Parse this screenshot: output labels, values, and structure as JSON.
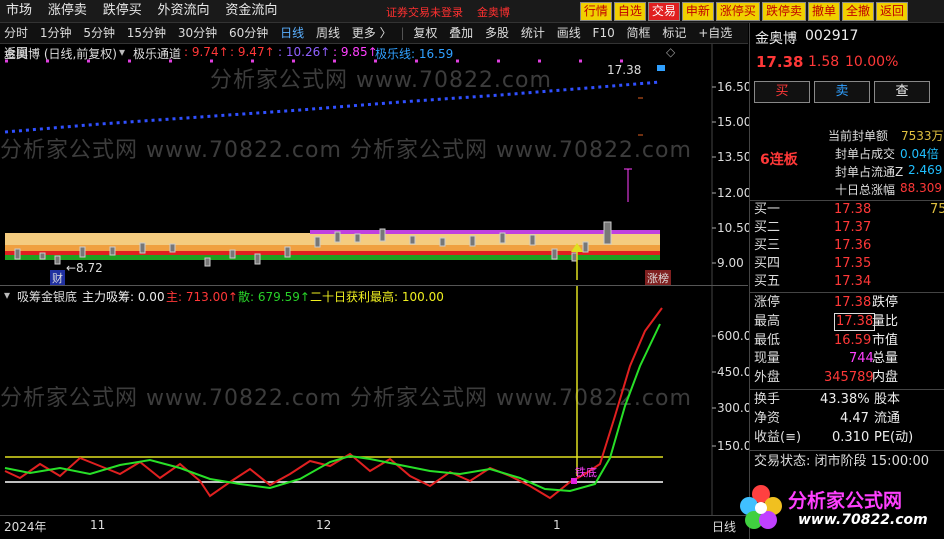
{
  "topmenu": [
    "市场",
    "涨停卖",
    "跌停买",
    "外资流向",
    "资金流向"
  ],
  "login_notice": "证券交易未登录",
  "login_stock": "金奥博",
  "toolbar_buttons": [
    "行情",
    "自选",
    "交易",
    "申新",
    "涨停买",
    "跌停卖",
    "撤单",
    "全撤",
    "返回"
  ],
  "periods": [
    "分时",
    "1分钟",
    "5分钟",
    "15分钟",
    "30分钟",
    "60分钟",
    "日线",
    "周线",
    "更多 〉"
  ],
  "active_period": "日线",
  "tools": [
    "复权",
    "叠加",
    "多股",
    "统计",
    "画线",
    "F10",
    "简框",
    "标记",
    "+自选",
    "返回"
  ],
  "pane1": {
    "title": "金奥博 (日线,前复权)",
    "indicator": "极乐通道",
    "v1": ": 9.74↑",
    "v2": ": 9.47↑",
    "v3": ": 10.26↑",
    "v4": ": 9.85↑",
    "v5": "极乐线: 16.59",
    "high_label": "17.38",
    "low_label": "←8.72",
    "cai_label": "财",
    "zhangbang_label": "涨榜",
    "axis": [
      "16.50",
      "15.00",
      "13.50",
      "12.00",
      "10.50",
      "9.00"
    ]
  },
  "pane2": {
    "name": "吸筹金银底",
    "main_label": "主力吸筹: 0.00",
    "zhu_label": "主: 713.00↑",
    "san_label": "散: 679.59↑",
    "profit_label": "二十日获利最高: 100.00",
    "tiedi_label": "铁底",
    "axis": [
      "600.0",
      "450.0",
      "300.0",
      "150.0"
    ]
  },
  "dates": [
    "2024年",
    "11",
    "12",
    "1"
  ],
  "date_corner": "日线",
  "stock": {
    "name": "金奥博",
    "code": "002917",
    "price": "17.38",
    "change": "1.58",
    "pct": "10.00%",
    "buy": "买",
    "sell": "卖",
    "query": "查",
    "streak": "6连板",
    "seal_amount_lbl": "当前封单额",
    "seal_amount": "7533万",
    "seal_vol_lbl": "封单占成交",
    "seal_vol": "0.04倍",
    "seal_float_lbl": "封单占流通Z",
    "seal_float": "2.469",
    "ten_day_lbl": "十日总涨幅",
    "ten_day": "88.309"
  },
  "orderbook": [
    {
      "label": "买一",
      "price": "17.38",
      "vol": "75"
    },
    {
      "label": "买二",
      "price": "17.37",
      "vol": ""
    },
    {
      "label": "买三",
      "price": "17.36",
      "vol": ""
    },
    {
      "label": "买四",
      "price": "17.35",
      "vol": ""
    },
    {
      "label": "买五",
      "price": "17.34",
      "vol": ""
    }
  ],
  "quote": {
    "zt_lbl": "涨停",
    "zt": "17.38",
    "dt_lbl": "跌停",
    "high_lbl": "最高",
    "high": "17.38",
    "lb_lbl": "量比",
    "low_lbl": "最低",
    "low": "16.59",
    "sz_lbl": "市值",
    "cur_lbl": "现量",
    "cur": "744",
    "zl_lbl": "总量",
    "wp_lbl": "外盘",
    "wp": "345789",
    "np_lbl": "内盘",
    "hs_lbl": "换手",
    "hs": "43.38%",
    "gb_lbl": "股本",
    "jz_lbl": "净资",
    "jz": "4.47",
    "lt_lbl": "流通",
    "sy_lbl": "收益(≡)",
    "sy": "0.310",
    "pe_lbl": "PE(动)",
    "status": "交易状态: 闭市阶段 15:00:00"
  },
  "logo": {
    "text": "分析家公式网",
    "url": "www.70822.com"
  },
  "watermark": "分析家公式网 www.70822.com"
}
